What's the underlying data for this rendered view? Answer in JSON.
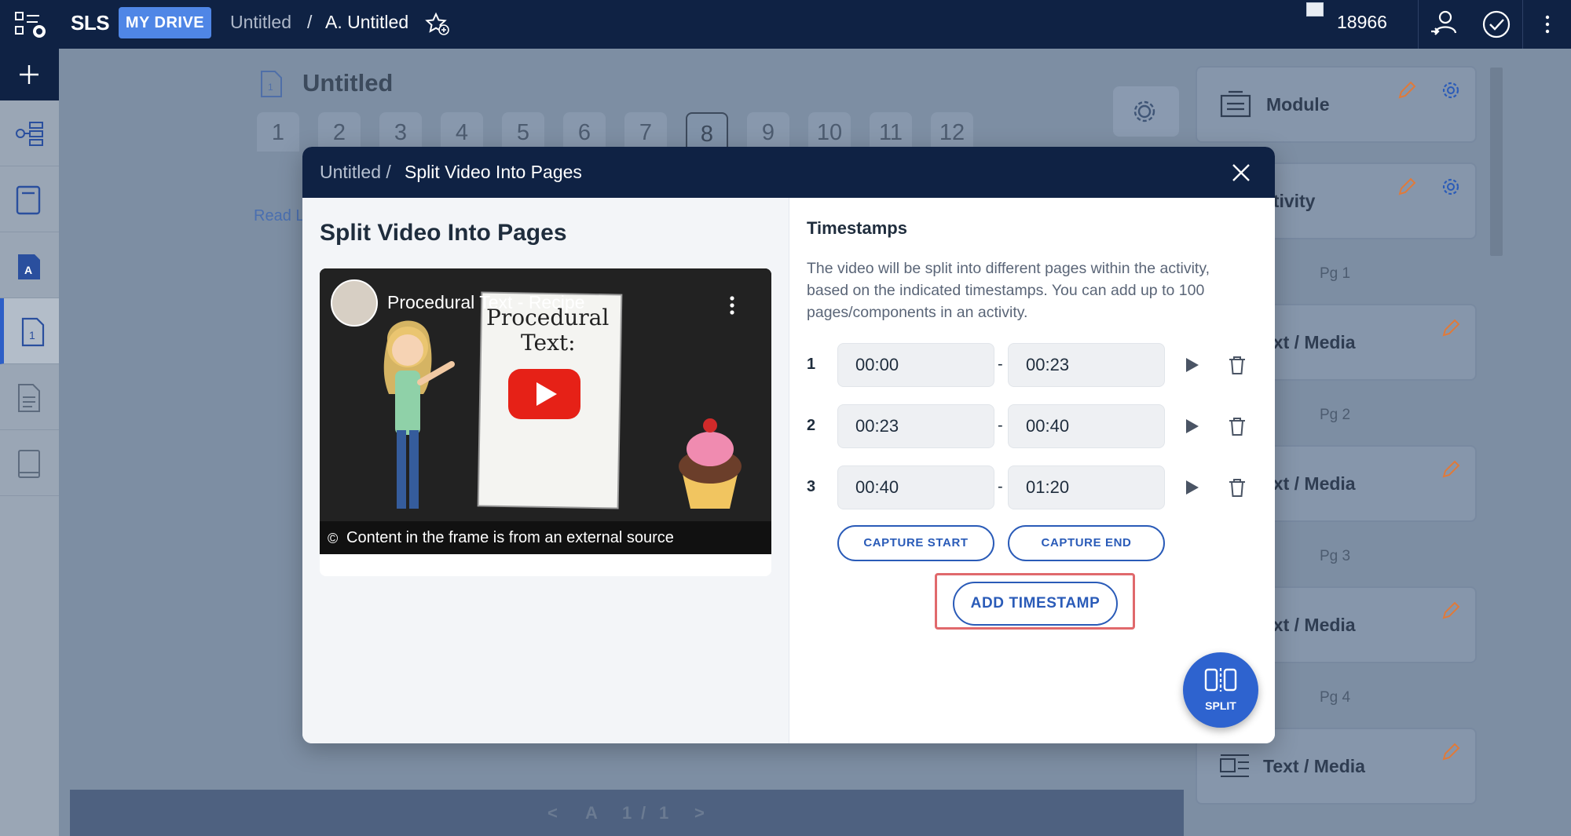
{
  "topbar": {
    "logo": "SLS",
    "my_drive": "MY DRIVE",
    "breadcrumb": [
      "Untitled",
      "/",
      "A. Untitled"
    ],
    "points": "18966"
  },
  "background": {
    "page_title": "Untitled",
    "page_tabs": [
      "1",
      "2",
      "3",
      "4",
      "5",
      "6",
      "7",
      "8",
      "9",
      "10",
      "11",
      "12"
    ],
    "selected_tab": "8",
    "read_link": "Read L",
    "right_panel": {
      "cards": [
        {
          "label": "Module"
        },
        {
          "label": "ctivity"
        },
        {
          "label": "ext / Media"
        },
        {
          "label": "ext / Media"
        },
        {
          "label": "ext / Media"
        },
        {
          "label": "Text / Media"
        }
      ],
      "pg_labels": [
        "Pg 1",
        "Pg 2",
        "Pg 3",
        "Pg 4"
      ]
    },
    "pagination": {
      "prev": "<",
      "label": "A",
      "current": "1",
      "sep": "/",
      "total": "1",
      "next": ">"
    }
  },
  "modal": {
    "header_crumb": "Untitled /",
    "header_title": "Split Video Into Pages",
    "left_title": "Split Video Into Pages",
    "video": {
      "title": "Procedural Text - Recipe",
      "board_text_1": "Procedural",
      "board_text_2": "Text:",
      "caption_icon": "©",
      "caption": "Content in the frame is from an external source"
    },
    "timestamps_title": "Timestamps",
    "description": "The video will be split into different pages within the activity, based on the indicated timestamps. You can add up to 100 pages/components in an activity.",
    "timestamps": [
      {
        "num": "1",
        "start": "00:00",
        "end": "00:23"
      },
      {
        "num": "2",
        "start": "00:23",
        "end": "00:40"
      },
      {
        "num": "3",
        "start": "00:40",
        "end": "01:20"
      }
    ],
    "dash": "-",
    "capture_start": "CAPTURE START",
    "capture_end": "CAPTURE END",
    "add_timestamp": "ADD TIMESTAMP",
    "split_label": "SPLIT"
  },
  "colors": {
    "navy": "#0f2244",
    "accent_blue": "#2e63cf",
    "highlight_red": "#e0696c"
  }
}
